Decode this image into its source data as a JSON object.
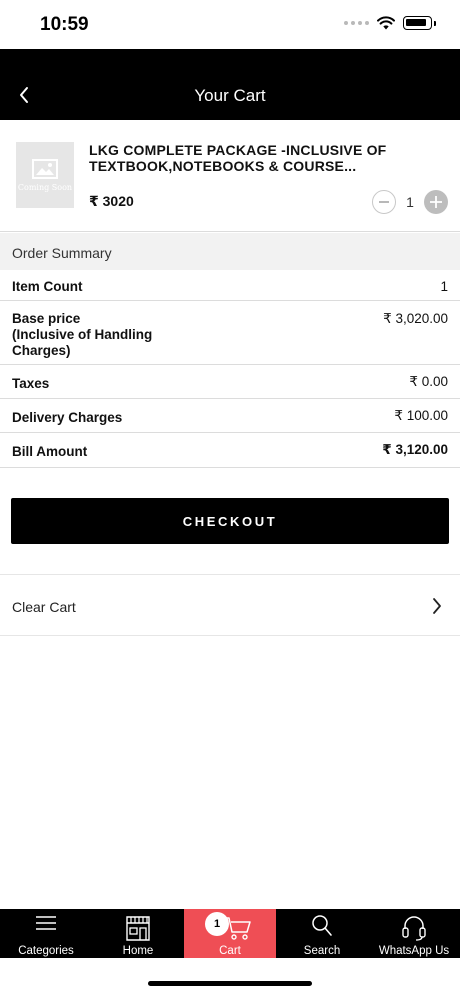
{
  "status_bar": {
    "time": "10:59"
  },
  "header": {
    "title": "Your Cart"
  },
  "cart_item": {
    "thumbnail_text": "Coming Soon",
    "title": "LKG COMPLETE PACKAGE -INCLUSIVE OF TEXTBOOK,NOTEBOOKS & COURSE...",
    "price": "₹ 3020",
    "quantity": "1"
  },
  "order_summary": {
    "heading": "Order Summary",
    "rows": [
      {
        "label": "Item Count",
        "value": "1"
      },
      {
        "label": "Base price\n(Inclusive of Handling\nCharges)",
        "value": "₹ 3,020.00"
      },
      {
        "label": "Taxes",
        "value": "₹ 0.00"
      },
      {
        "label": "Delivery Charges",
        "value": "₹ 100.00"
      },
      {
        "label": "Bill Amount",
        "value": "₹ 3,120.00"
      }
    ]
  },
  "checkout": {
    "label": "CHECKOUT"
  },
  "clear_cart": {
    "label": "Clear Cart"
  },
  "tabs": [
    {
      "label": "Categories",
      "icon": "menu-icon"
    },
    {
      "label": "Home",
      "icon": "store-icon"
    },
    {
      "label": "Cart",
      "icon": "cart-icon",
      "badge": "1",
      "active": true
    },
    {
      "label": "Search",
      "icon": "search-icon"
    },
    {
      "label": "WhatsApp Us",
      "icon": "headset-icon"
    }
  ],
  "colors": {
    "header_bg": "#000000",
    "active_tab": "#ef4e55",
    "checkout_bg": "#000000"
  }
}
